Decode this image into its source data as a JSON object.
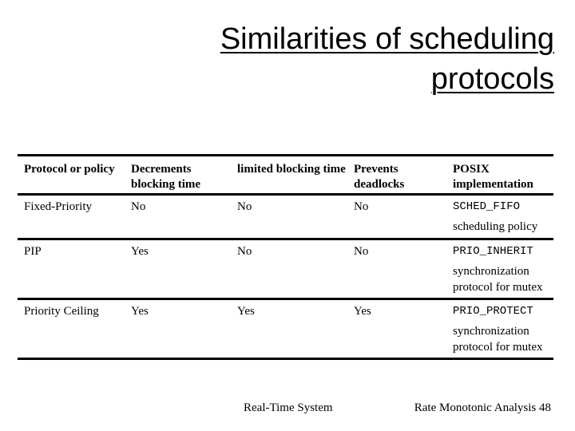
{
  "slide": {
    "title_line1": "Similarities of scheduling",
    "title_line2": "protocols"
  },
  "table": {
    "headers": [
      "Protocol or policy",
      "Decrements blocking time",
      "limited blocking time",
      "Prevents deadlocks",
      "POSIX implementation"
    ],
    "rows": [
      {
        "protocol": "Fixed-Priority",
        "decrements_blocking": "No",
        "limited_blocking": "No",
        "prevents_deadlocks": "No",
        "posix_name": "SCHED_FIFO",
        "posix_desc": "scheduling policy"
      },
      {
        "protocol": "PIP",
        "decrements_blocking": "Yes",
        "limited_blocking": "No",
        "prevents_deadlocks": "No",
        "posix_name": "PRIO_INHERIT",
        "posix_desc": "synchronization protocol for mutex"
      },
      {
        "protocol": "Priority Ceiling",
        "decrements_blocking": "Yes",
        "limited_blocking": "Yes",
        "prevents_deadlocks": "Yes",
        "posix_name": "PRIO_PROTECT",
        "posix_desc": "synchronization protocol for mutex"
      }
    ]
  },
  "footer": {
    "left": "Real-Time System",
    "right": "Rate Monotonic Analysis 48"
  }
}
